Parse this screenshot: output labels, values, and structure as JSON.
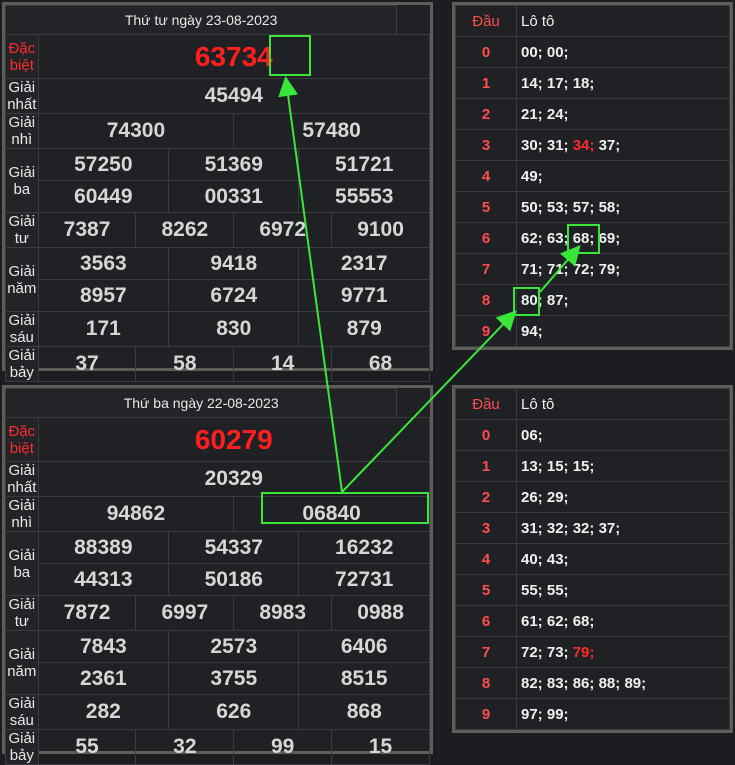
{
  "board1": {
    "title": "Thứ tư ngày 23-08-2023",
    "labels": [
      "Đặc biệt",
      "Giải nhất",
      "Giải nhì",
      "Giải ba",
      "Giải tư",
      "Giải năm",
      "Giải sáu",
      "Giải bảy"
    ],
    "dac_biet": "63734",
    "nhat": "45494",
    "nhi": [
      "74300",
      "57480"
    ],
    "ba": [
      "57250",
      "51369",
      "51721",
      "60449",
      "00331",
      "55553"
    ],
    "tu": [
      "7387",
      "8262",
      "6972",
      "9100"
    ],
    "nam": [
      "3563",
      "9418",
      "2317",
      "8957",
      "6724",
      "9771"
    ],
    "sau": [
      "171",
      "830",
      "879"
    ],
    "bay": [
      "37",
      "58",
      "14",
      "68"
    ]
  },
  "board2": {
    "title": "Thứ ba ngày 22-08-2023",
    "labels": [
      "Đặc biệt",
      "Giải nhất",
      "Giải nhì",
      "Giải ba",
      "Giải tư",
      "Giải năm",
      "Giải sáu",
      "Giải bảy"
    ],
    "dac_biet": "60279",
    "nhat": "20329",
    "nhi": [
      "94862",
      "06840"
    ],
    "ba": [
      "88389",
      "54337",
      "16232",
      "44313",
      "50186",
      "72731"
    ],
    "tu": [
      "7872",
      "6997",
      "8983",
      "0988"
    ],
    "nam": [
      "7843",
      "2573",
      "6406",
      "2361",
      "3755",
      "8515"
    ],
    "sau": [
      "282",
      "626",
      "868"
    ],
    "bay": [
      "55",
      "32",
      "99",
      "15"
    ]
  },
  "loto1": {
    "head_dau": "Đầu",
    "head_loto": "Lô tô",
    "rows": [
      {
        "d": "0",
        "v": "00; 00;"
      },
      {
        "d": "1",
        "v": "14; 17; 18;"
      },
      {
        "d": "2",
        "v": "21; 24;"
      },
      {
        "d": "3",
        "v": "30; 31; 34; 37;"
      },
      {
        "d": "4",
        "v": "49;"
      },
      {
        "d": "5",
        "v": "50; 53; 57; 58;"
      },
      {
        "d": "6",
        "v": "62; 63; 68; 69;"
      },
      {
        "d": "7",
        "v": "71; 71; 72; 79;"
      },
      {
        "d": "8",
        "v": "80; 87;"
      },
      {
        "d": "9",
        "v": "94;"
      }
    ],
    "highlight": "34"
  },
  "loto2": {
    "head_dau": "Đầu",
    "head_loto": "Lô tô",
    "rows": [
      {
        "d": "0",
        "v": "06;"
      },
      {
        "d": "1",
        "v": "13; 15; 15;"
      },
      {
        "d": "2",
        "v": "26; 29;"
      },
      {
        "d": "3",
        "v": "31; 32; 32; 37;"
      },
      {
        "d": "4",
        "v": "40; 43;"
      },
      {
        "d": "5",
        "v": "55; 55;"
      },
      {
        "d": "6",
        "v": "61; 62; 68;"
      },
      {
        "d": "7",
        "v": "72; 73; 79;"
      },
      {
        "d": "8",
        "v": "82; 83; 86; 88; 89;"
      },
      {
        "d": "9",
        "v": "97; 99;"
      }
    ],
    "highlight": "79"
  },
  "colors": {
    "accent_green": "#39e639",
    "red": "#ff1f1f",
    "frame": "#5f5d57"
  }
}
